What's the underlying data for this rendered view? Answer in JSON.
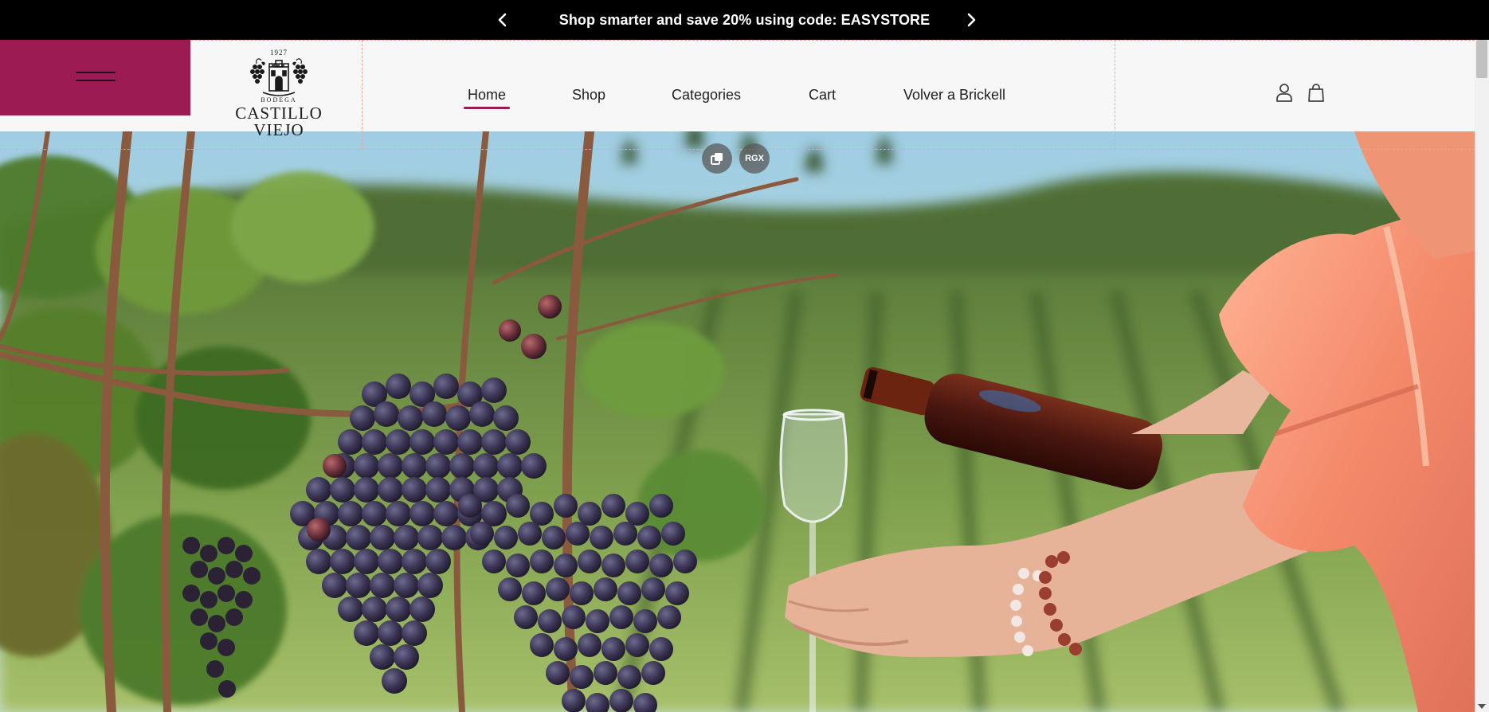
{
  "announcement": {
    "text": "Shop smarter and save 20% using code: EASYSTORE",
    "prev_icon": "chevron-left-icon",
    "next_icon": "chevron-right-icon"
  },
  "brand": {
    "year": "1927",
    "subtitle": "BODEGA",
    "name_line1": "CASTILLO",
    "name_line2": "VIEJO",
    "accent_color": "#9b1b52"
  },
  "nav": {
    "items": [
      {
        "label": "Home",
        "active": true
      },
      {
        "label": "Shop",
        "active": false
      },
      {
        "label": "Categories",
        "active": false
      },
      {
        "label": "Cart",
        "active": false
      },
      {
        "label": "Volver a Brickell",
        "active": false
      }
    ]
  },
  "header_icons": {
    "account": "user-icon",
    "cart": "shopping-bag-icon",
    "menu": "hamburger-menu-icon"
  },
  "hero": {
    "description": "vineyard-grapes-wine-pour",
    "overlay_buttons": {
      "copy_icon": "copy-image-icon",
      "rgx_label": "RGX"
    }
  }
}
